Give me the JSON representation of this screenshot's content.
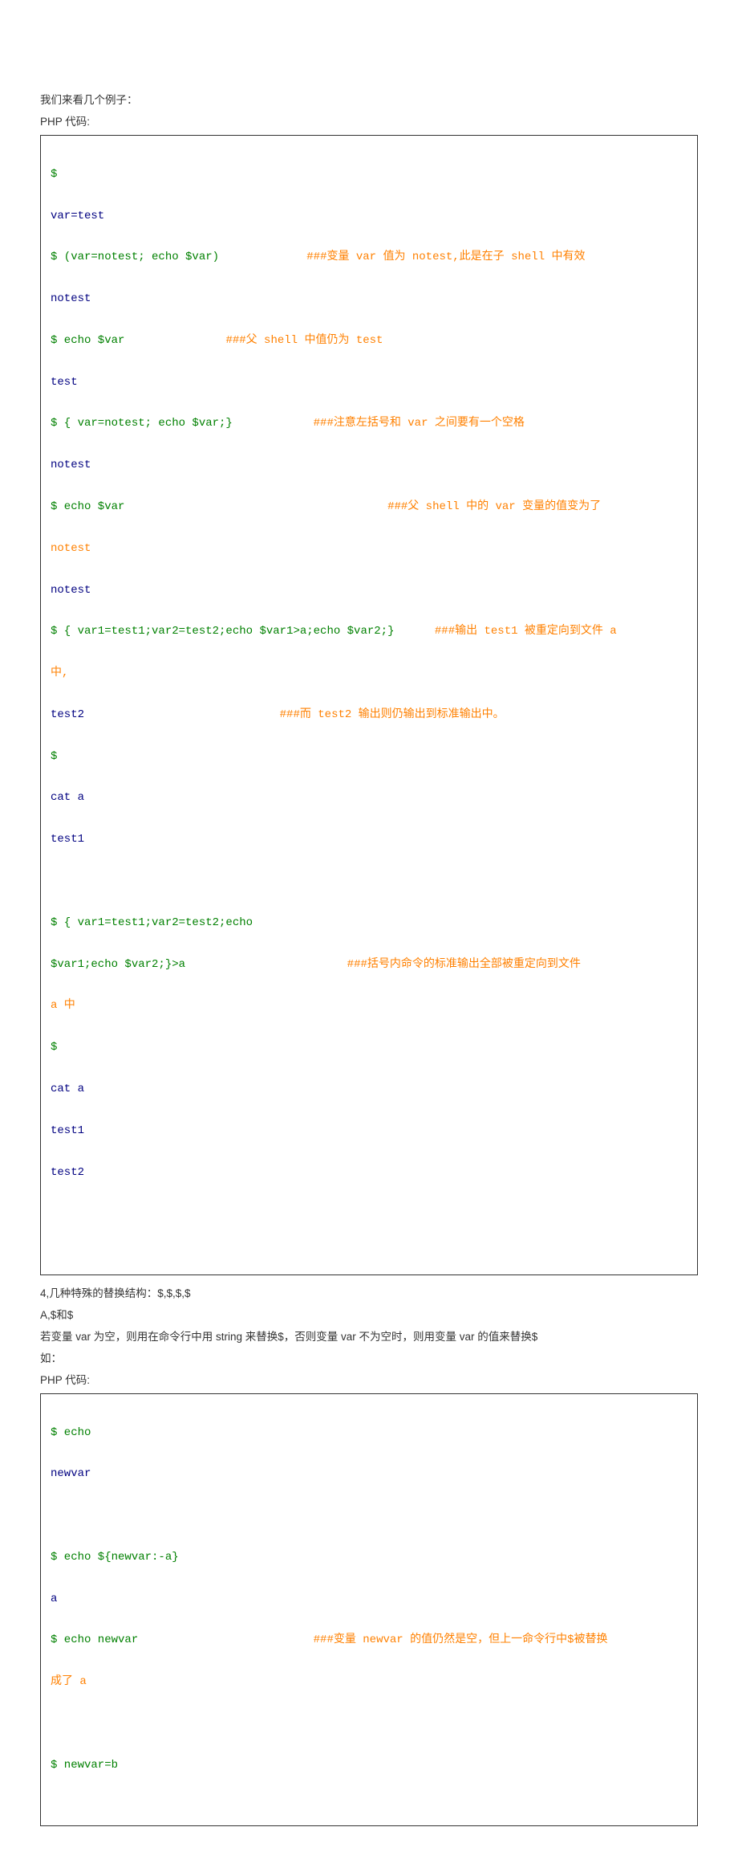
{
  "intro1": "我们来看几个例子：",
  "label1": "PHP 代码:",
  "block1": {
    "l0": "$",
    "l1": "var=test",
    "l2a": "$ (var=notest; echo $var)             ",
    "l2b": "###变量 var 值为 notest,此是在子 shell 中有效",
    "l3": "notest",
    "l4a": "$ echo $var               ",
    "l4b": "###父 shell 中值仍为 test",
    "l5": "test",
    "l6a": "$ { var=notest; echo $var;}            ",
    "l6b": "###注意左括号和 var 之间要有一个空格",
    "l7": "notest",
    "l8a": "$ echo $var                                       ",
    "l8b": "###父 shell 中的 var 变量的值变为了",
    "l8c": "notest",
    "l9": "notest",
    "l10a": "$ { var1=test1;var2=test2;echo $var1>a;echo $var2;}      ",
    "l10b": "###输出 test1 被重定向到文件 a",
    "l10c": "中,",
    "l11a": "test2                             ",
    "l11b": "###而 test2 输出则仍输出到标准输出中。",
    "l12": "$",
    "l13": "cat a",
    "l14": "test1",
    "l15": "",
    "l16": "$ { var1=test1;var2=test2;echo",
    "l17a": "$var1;echo $var2;}>a                        ",
    "l17b": "###括号内命令的标准输出全部被重定向到文件",
    "l17c": "a 中",
    "l18": "$",
    "l19": "cat a",
    "l20": "test1",
    "l21": "test2",
    "l22": ""
  },
  "para2": "4,几种特殊的替换结构：$,$,$,$",
  "para3": "A,$和$",
  "para4": "若变量 var 为空，则用在命令行中用 string 来替换$，否则变量 var 不为空时，则用变量 var 的值来替换$",
  "para5": "如：",
  "label2": "PHP 代码:",
  "block2": {
    "l0": "$ echo",
    "l1": "newvar",
    "l2": "",
    "l3": "$ echo ${newvar:-a}",
    "l4": "a",
    "l5a": "$ echo newvar                          ",
    "l5b": "###变量 newvar 的值仍然是空，但上一命令行中$被替换",
    "l5c": "成了 a",
    "l6": "",
    "l7": "$ newvar=b"
  }
}
